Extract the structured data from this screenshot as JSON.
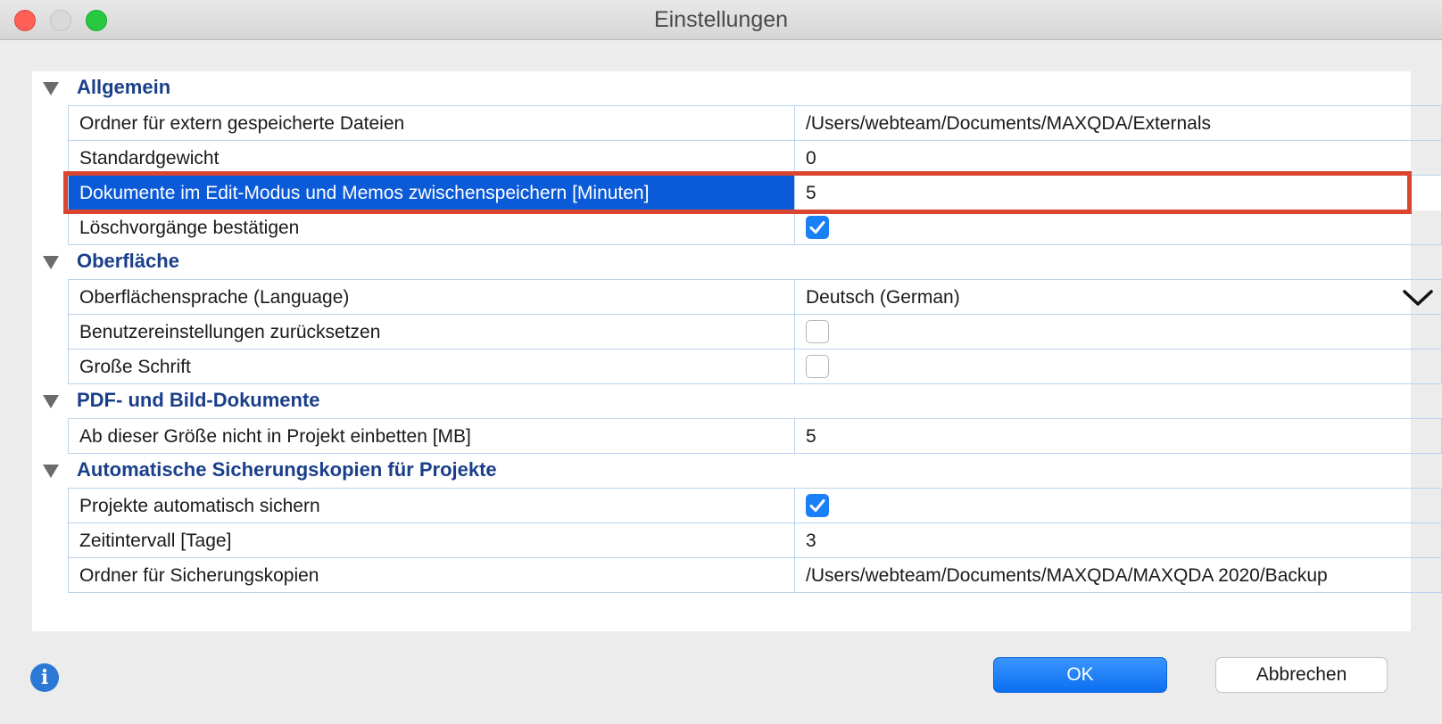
{
  "window": {
    "title": "Einstellungen"
  },
  "sections": [
    {
      "label": "Allgemein",
      "rows": [
        {
          "label": "Ordner für extern gespeicherte Dateien",
          "value": "/Users/webteam/Documents/MAXQDA/Externals"
        },
        {
          "label": "Standardgewicht",
          "value": "0"
        },
        {
          "label": "Dokumente im Edit-Modus und Memos zwischenspeichern [Minuten]",
          "value": "5",
          "selected": true
        },
        {
          "label": "Löschvorgänge bestätigen",
          "checkbox": true
        }
      ]
    },
    {
      "label": "Oberfläche",
      "rows": [
        {
          "label": "Oberflächensprache (Language)",
          "value": "Deutsch (German)",
          "dropdown": true
        },
        {
          "label": "Benutzereinstellungen zurücksetzen",
          "checkbox": false
        },
        {
          "label": "Große Schrift",
          "checkbox": false
        }
      ]
    },
    {
      "label": "PDF- und Bild-Dokumente",
      "rows": [
        {
          "label": "Ab dieser Größe nicht in Projekt einbetten [MB]",
          "value": "5"
        }
      ]
    },
    {
      "label": "Automatische Sicherungskopien für Projekte",
      "rows": [
        {
          "label": "Projekte automatisch sichern",
          "checkbox": true
        },
        {
          "label": "Zeitintervall [Tage]",
          "value": "3"
        },
        {
          "label": "Ordner für Sicherungskopien",
          "value": "/Users/webteam/Documents/MAXQDA/MAXQDA 2020/Backup"
        }
      ]
    }
  ],
  "footer": {
    "ok_label": "OK",
    "cancel_label": "Abbrechen",
    "info_icon": "info-icon"
  },
  "colors": {
    "accent": "#1a80f8",
    "selection": "#0b5ad8",
    "section_title": "#1a3f8a",
    "highlight": "#d9452f"
  }
}
